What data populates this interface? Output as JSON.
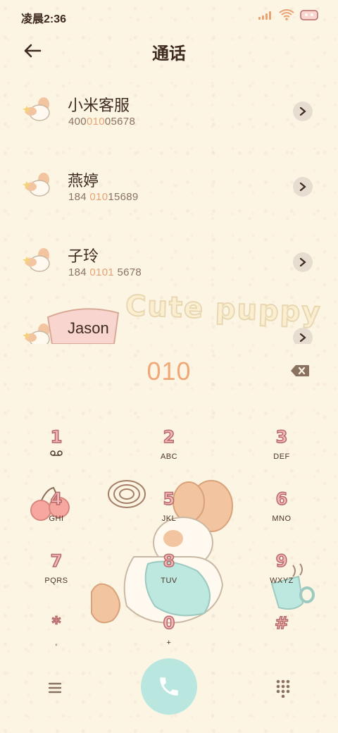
{
  "status_bar": {
    "time": "凌晨2:36"
  },
  "header": {
    "title": "通话"
  },
  "contacts": [
    {
      "name": "小米客服",
      "number_parts": [
        "400",
        "010",
        "05678"
      ]
    },
    {
      "name": "燕婷",
      "number_parts": [
        "184 ",
        "010",
        "15689"
      ]
    },
    {
      "name": "子玲",
      "number_parts": [
        "184 ",
        "0101",
        " 5678"
      ]
    },
    {
      "name": "Jason",
      "number_parts": [
        "",
        "",
        ""
      ]
    }
  ],
  "decoration": {
    "text": "Cute puppy"
  },
  "dialer": {
    "input": "010"
  },
  "keypad": [
    {
      "digit": "1",
      "letters": ""
    },
    {
      "digit": "2",
      "letters": "ABC"
    },
    {
      "digit": "3",
      "letters": "DEF"
    },
    {
      "digit": "4",
      "letters": "GHI"
    },
    {
      "digit": "5",
      "letters": "JKL"
    },
    {
      "digit": "6",
      "letters": "MNO"
    },
    {
      "digit": "7",
      "letters": "PQRS"
    },
    {
      "digit": "8",
      "letters": "TUV"
    },
    {
      "digit": "9",
      "letters": "WXYZ"
    },
    {
      "digit": "*",
      "letters": ","
    },
    {
      "digit": "0",
      "letters": "+"
    },
    {
      "digit": "#",
      "letters": ""
    }
  ],
  "icons": {
    "back": "back-arrow-icon",
    "chevron": "chevron-right-icon",
    "delete": "backspace-icon",
    "menu": "menu-icon",
    "call": "phone-icon",
    "dialpad": "dialpad-grid-icon",
    "voicemail": "voicemail-icon"
  },
  "colors": {
    "background": "#fdf5e4",
    "accent_highlight": "#e8a273",
    "call_button": "#b9e7df",
    "digit_fill": "#f3b6b6"
  }
}
